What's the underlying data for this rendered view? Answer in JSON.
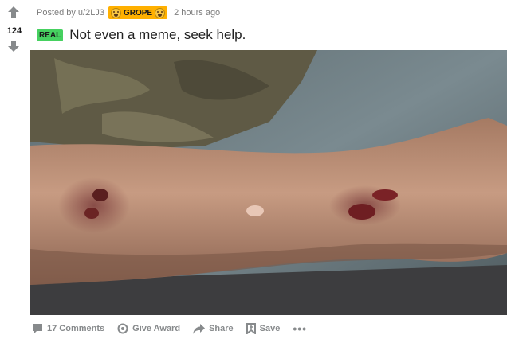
{
  "post": {
    "score": "124",
    "posted_by_prefix": "Posted by",
    "username": "u/2LJ3",
    "user_flair": "GROPE",
    "time_ago": "2 hours ago",
    "tag": "REAL",
    "title": "Not even a meme, seek help."
  },
  "actions": {
    "comments_label": "17 Comments",
    "award_label": "Give Award",
    "share_label": "Share",
    "save_label": "Save",
    "more_label": "•••"
  },
  "colors": {
    "flair_bg": "#ffb000",
    "tag_bg": "#46d160",
    "action_text": "#878a8c",
    "vote_arrow": "#878a8c"
  },
  "icons": [
    "upvote-icon",
    "downvote-icon",
    "flair-emoji-icon",
    "comment-icon",
    "award-icon",
    "share-icon",
    "save-icon",
    "more-icon"
  ]
}
